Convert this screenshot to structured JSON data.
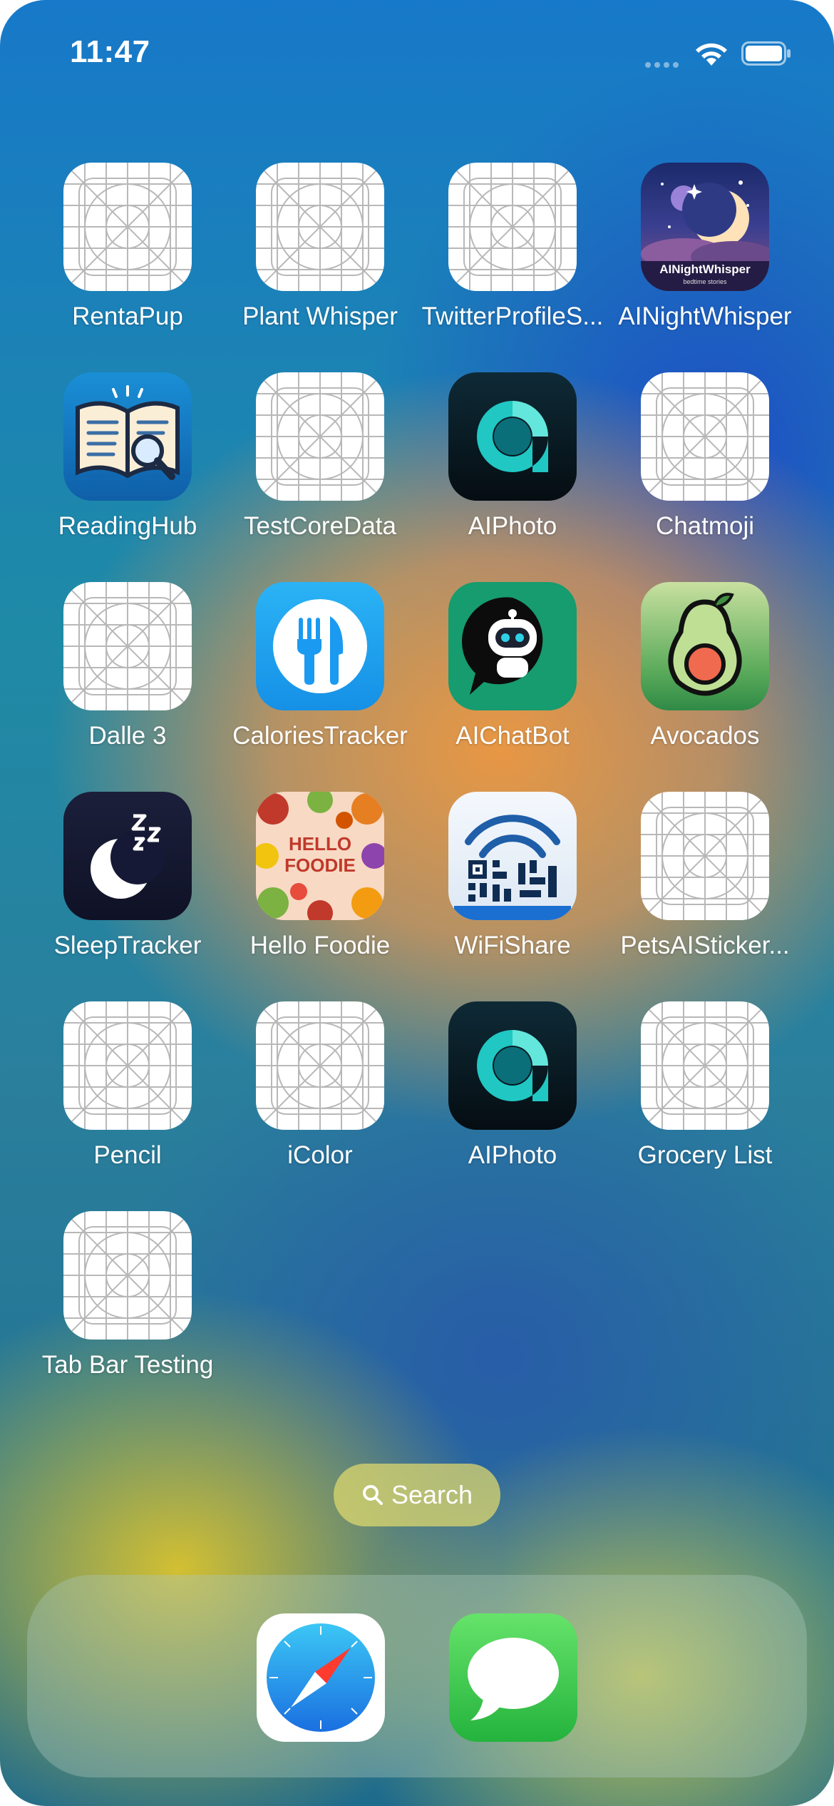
{
  "status_bar": {
    "time": "11:47"
  },
  "apps": [
    {
      "label": "RentaPup",
      "icon": "placeholder-grid-icon"
    },
    {
      "label": "Plant Whisper",
      "icon": "placeholder-grid-icon"
    },
    {
      "label": "TwitterProfileS...",
      "icon": "placeholder-grid-icon"
    },
    {
      "label": "AINightWhisper",
      "icon": "moon-night-icon",
      "icon_text": "AINightWhisper",
      "icon_subtext": "bedtime stories"
    },
    {
      "label": "ReadingHub",
      "icon": "open-book-icon"
    },
    {
      "label": "TestCoreData",
      "icon": "placeholder-grid-icon"
    },
    {
      "label": "AIPhoto",
      "icon": "aiphoto-logo-icon"
    },
    {
      "label": "Chatmoji",
      "icon": "placeholder-grid-icon"
    },
    {
      "label": "Dalle 3",
      "icon": "placeholder-grid-icon"
    },
    {
      "label": "CaloriesTracker",
      "icon": "fork-knife-icon"
    },
    {
      "label": "AIChatBot",
      "icon": "robot-chat-icon"
    },
    {
      "label": "Avocados",
      "icon": "avocado-icon"
    },
    {
      "label": "SleepTracker",
      "icon": "moon-zzz-icon"
    },
    {
      "label": "Hello Foodie",
      "icon": "food-collage-icon",
      "icon_text": "HELLO FOODIE"
    },
    {
      "label": "WiFiShare",
      "icon": "wifi-qr-icon"
    },
    {
      "label": "PetsAISticker...",
      "icon": "placeholder-grid-icon"
    },
    {
      "label": "Pencil",
      "icon": "placeholder-grid-icon"
    },
    {
      "label": "iColor",
      "icon": "placeholder-grid-icon"
    },
    {
      "label": "AIPhoto",
      "icon": "aiphoto-logo-icon"
    },
    {
      "label": "Grocery List",
      "icon": "placeholder-grid-icon"
    },
    {
      "label": "Tab Bar Testing",
      "icon": "placeholder-grid-icon"
    }
  ],
  "search": {
    "label": "Search"
  },
  "dock": [
    {
      "name": "safari-compass-icon"
    },
    {
      "name": "messages-bubble-icon"
    }
  ],
  "colors": {
    "accent_teal": "#1fc3c0",
    "dock_messages_green": "#35c759",
    "safari_blue": "#1e88e5"
  }
}
